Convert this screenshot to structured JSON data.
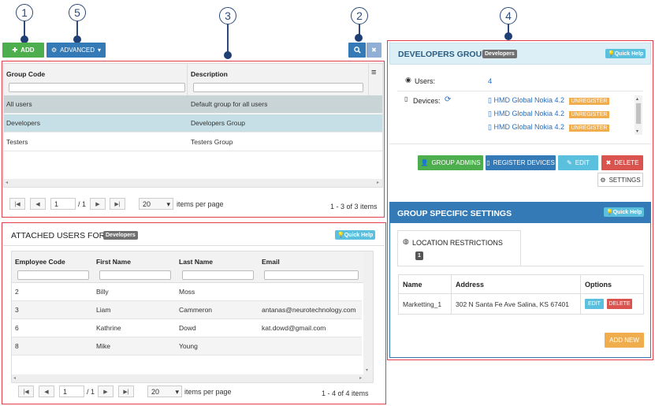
{
  "callouts": [
    "1",
    "2",
    "3",
    "4",
    "5"
  ],
  "toolbar": {
    "add_label": "ADD",
    "advanced_label": "ADVANCED"
  },
  "groups_grid": {
    "columns": [
      "Group Code",
      "Description"
    ],
    "rows": [
      {
        "code": "All users",
        "description": "Default group for all users"
      },
      {
        "code": "Developers",
        "description": "Developers Group"
      },
      {
        "code": "Testers",
        "description": "Testers Group"
      }
    ],
    "pager": {
      "page": "1",
      "of_pages": "/ 1",
      "page_size": "20",
      "items_per_page": "items per page",
      "summary": "1 - 3 of 3 items"
    }
  },
  "attached_users": {
    "title": "ATTACHED USERS FOR",
    "badge": "Developers",
    "quick_help": "Quick Help",
    "columns": [
      "Employee Code",
      "First Name",
      "Last Name",
      "Email"
    ],
    "rows": [
      {
        "code": "2",
        "first": "Billy",
        "last": "Moss",
        "email": ""
      },
      {
        "code": "3",
        "first": "Liam",
        "last": "Cammeron",
        "email": "antanas@neurotechnology.com"
      },
      {
        "code": "6",
        "first": "Kathrine",
        "last": "Dowd",
        "email": "kat.dowd@gmail.com"
      },
      {
        "code": "8",
        "first": "Mike",
        "last": "Young",
        "email": ""
      }
    ],
    "pager": {
      "page": "1",
      "of_pages": "/ 1",
      "page_size": "20",
      "items_per_page": "items per page",
      "summary": "1 - 4 of 4 items"
    }
  },
  "group_details": {
    "title": "DEVELOPERS GROUP",
    "badge": "Developers",
    "quick_help": "Quick Help",
    "users_label": "Users:",
    "users_count": "4",
    "devices_label": "Devices:",
    "devices": [
      {
        "name": "HMD Global Nokia 4.2",
        "status": "UNREGISTER"
      },
      {
        "name": "HMD Global Nokia 4.2",
        "status": "UNREGISTER"
      },
      {
        "name": "HMD Global Nokia 4.2",
        "status": "UNREGISTER"
      }
    ],
    "buttons": {
      "group_admins": "GROUP ADMINS",
      "register_devices": "REGISTER DEVICES",
      "edit": "EDIT",
      "delete": "DELETE",
      "settings": "SETTINGS"
    }
  },
  "group_settings": {
    "title": "GROUP SPECIFIC SETTINGS",
    "quick_help": "Quick Help",
    "tab_label": "LOCATION RESTRICTIONS",
    "tab_count": "1",
    "columns": [
      "Name",
      "Address",
      "Options"
    ],
    "rows": [
      {
        "name": "Marketting_1",
        "address": "302 N Santa Fe Ave Salina, KS 67401",
        "edit": "EDIT",
        "delete": "DELETE"
      }
    ],
    "add_new": "ADD NEW"
  },
  "colors": {
    "green": "#4cae4c",
    "blue": "#337ab7",
    "info": "#5bc0de",
    "danger": "#d9534f",
    "warning": "#f0ad4e",
    "highlight": "#c6dfe6"
  }
}
